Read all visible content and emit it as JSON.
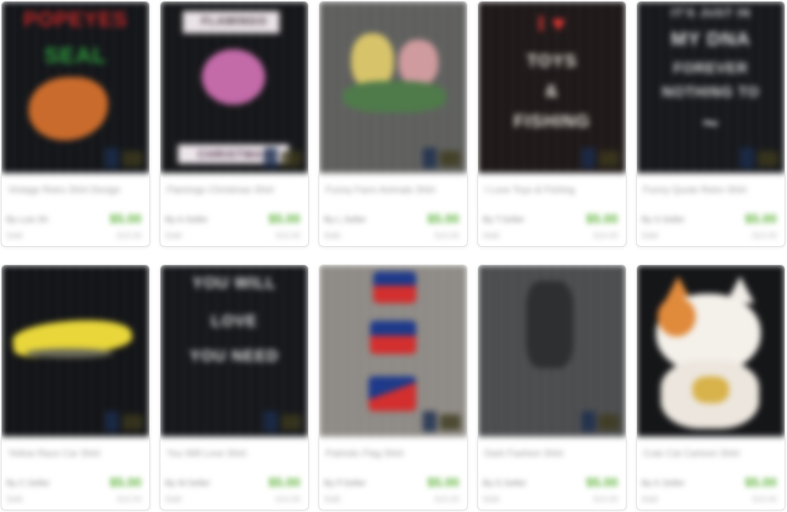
{
  "products": [
    {
      "id_label": "card-1",
      "title": "Vintage Retro Shirt Design",
      "seller": "By Luis Sh",
      "price": "$5.00",
      "shipping": "Sold",
      "original": "$18.99",
      "poster_lines": [
        "POPEYES",
        "SEAL"
      ],
      "bg": "#121418",
      "fg": "#c62828"
    },
    {
      "id_label": "card-2",
      "title": "Flamingo Christmas Shirt",
      "seller": "By A.Seller",
      "price": "$5.00",
      "shipping": "Sold",
      "original": "$18.99",
      "poster_lines": [
        "FLAMINGO",
        "",
        "",
        "",
        "CHRISTMAS"
      ],
      "bg": "#141518",
      "fg": "#e2a9d1"
    },
    {
      "id_label": "card-3",
      "title": "Funny Farm Animals Shirt",
      "seller": "By L.Seller",
      "price": "$5.00",
      "shipping": "Sold",
      "original": "$18.99",
      "poster_lines": [],
      "bg": "#5e5f5d",
      "fg": "#d8c268"
    },
    {
      "id_label": "card-4",
      "title": "I Love Toys & Fishing",
      "seller": "By T.Seller",
      "price": "$5.00",
      "shipping": "Sold",
      "original": "$18.99",
      "poster_lines": [
        "I ♥",
        "TOYS",
        "&",
        "FISHING"
      ],
      "bg": "#1d1717",
      "fg": "#e8e2dc"
    },
    {
      "id_label": "card-5",
      "title": "Funny Quote Retro Shirt",
      "seller": "By S.Seller",
      "price": "$5.00",
      "shipping": "Sold",
      "original": "$18.99",
      "poster_lines": [
        "IT'S JUST IN",
        "MY DNA",
        "FOREVER",
        "NOTHING TO",
        "~"
      ],
      "bg": "#15171b",
      "fg": "#dddddd"
    },
    {
      "id_label": "card-6",
      "title": "Yellow Race Car Shirt",
      "seller": "By C.Seller",
      "price": "$5.00",
      "shipping": "Sold",
      "original": "$18.99",
      "poster_lines": [],
      "bg": "#121316",
      "fg": "#e8d63a"
    },
    {
      "id_label": "card-7",
      "title": "You Will Love Shirt",
      "seller": "By W.Seller",
      "price": "$5.00",
      "shipping": "Sold",
      "original": "$18.99",
      "poster_lines": [
        "YOU WILL",
        "",
        "LOVE",
        "YOU NEED"
      ],
      "bg": "#14161a",
      "fg": "#e2e2e2"
    },
    {
      "id_label": "card-8",
      "title": "Patriotic Flag Shirt",
      "seller": "By P.Seller",
      "price": "$5.00",
      "shipping": "Sold",
      "original": "$18.99",
      "poster_lines": [],
      "bg": "#8e8a85",
      "fg": "#1f3a8a"
    },
    {
      "id_label": "card-9",
      "title": "Dark Fashion Shirt",
      "seller": "By D.Seller",
      "price": "$5.00",
      "shipping": "Sold",
      "original": "$18.99",
      "poster_lines": [],
      "bg": "#4b4c4e",
      "fg": "#2e2f31"
    },
    {
      "id_label": "card-10",
      "title": "Cute Cat Cartoon Shirt",
      "seller": "By K.Seller",
      "price": "$5.00",
      "shipping": "Sold",
      "original": "$18.99",
      "poster_lines": [],
      "bg": "#151618",
      "fg": "#f4f0ea"
    }
  ],
  "accent_price_color": "#5fb33b"
}
